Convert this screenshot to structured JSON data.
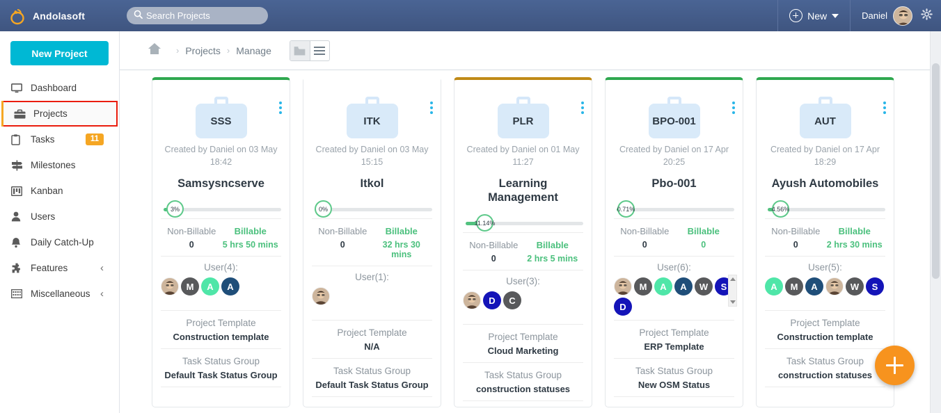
{
  "topbar": {
    "brand": "Andolasoft",
    "logo_icon": "orange-ring-logo-icon",
    "search": {
      "placeholder": "Search Projects",
      "value": "",
      "icon": "search-icon"
    },
    "new_button": {
      "label": "New",
      "icon": "plus-circle-icon",
      "caret": "chevron-down-icon"
    },
    "user_name": "Daniel",
    "avatar_icon": "user-avatar",
    "settings_icon": "gear-icon"
  },
  "sidebar": {
    "new_project_label": "New Project",
    "items": [
      {
        "label": "Dashboard",
        "icon": "monitor-icon",
        "active": false,
        "badge": "",
        "chevron": ""
      },
      {
        "label": "Projects",
        "icon": "briefcase-icon",
        "active": true,
        "badge": "",
        "chevron": ""
      },
      {
        "label": "Tasks",
        "icon": "clipboard-icon",
        "active": false,
        "badge": "11",
        "chevron": ""
      },
      {
        "label": "Milestones",
        "icon": "signpost-icon",
        "active": false,
        "badge": "",
        "chevron": ""
      },
      {
        "label": "Kanban",
        "icon": "kanban-board-icon",
        "active": false,
        "badge": "",
        "chevron": ""
      },
      {
        "label": "Users",
        "icon": "person-icon",
        "active": false,
        "badge": "",
        "chevron": ""
      },
      {
        "label": "Daily Catch-Up",
        "icon": "bell-icon",
        "active": false,
        "badge": "",
        "chevron": ""
      },
      {
        "label": "Features",
        "icon": "puzzle-icon",
        "active": false,
        "badge": "",
        "chevron": "‹"
      },
      {
        "label": "Miscellaneous",
        "icon": "grid-icon",
        "active": false,
        "badge": "",
        "chevron": "‹"
      }
    ]
  },
  "breadcrumb": {
    "home_icon": "home-icon",
    "sep": "›",
    "items": [
      "Projects",
      "Manage"
    ],
    "view_toggle": {
      "grid_label": "grid-view",
      "list_label": "list-view",
      "selected": "grid-view"
    }
  },
  "labels": {
    "non_billable": "Non-Billable",
    "billable": "Billable",
    "project_template": "Project Template",
    "task_status_group": "Task Status Group"
  },
  "fab": {
    "icon": "plus-icon",
    "color": "#f7931e"
  },
  "colors": {
    "accent": "#00b8d4",
    "brand_header": "#4a6494",
    "green": "#4bc07d",
    "orange": "#f7931e",
    "active_outline": "#ea1c0d",
    "card_top_green": "#2fa84f",
    "card_top_gold": "#c08a17"
  },
  "cards": [
    {
      "code": "SSS",
      "top_color": "#2fa84f",
      "created": "Created by Daniel on 03 May 18:42",
      "name": "Samsysncserve",
      "progress_pct": 3,
      "progress_label": "3%",
      "non_billable": "0",
      "billable": "5 hrs 50 mins",
      "users_label": "User(4):",
      "users": [
        {
          "type": "photo",
          "letter": "",
          "color": "#d9c3ae"
        },
        {
          "type": "initial",
          "letter": "M",
          "color": "#58595b"
        },
        {
          "type": "initial",
          "letter": "A",
          "color": "#4fe6a8"
        },
        {
          "type": "initial",
          "letter": "A",
          "color": "#1f4e79"
        }
      ],
      "has_user_scroll": false,
      "template": "Construction template",
      "status_group": "Default Task Status Group"
    },
    {
      "code": "ITK",
      "top_color": "#ffffff",
      "created": "Created by Daniel on 03 May 15:15",
      "name": "Itkol",
      "progress_pct": 0,
      "progress_label": "0%",
      "non_billable": "0",
      "billable": "32 hrs 30 mins",
      "users_label": "User(1):",
      "users": [
        {
          "type": "photo",
          "letter": "",
          "color": "#d9c3ae"
        }
      ],
      "has_user_scroll": false,
      "template": "N/A",
      "status_group": "Default Task Status Group"
    },
    {
      "code": "PLR",
      "top_color": "#c08a17",
      "created": "Created by Daniel on 01 May 11:27",
      "name": "Learning Management",
      "progress_pct": 11.14,
      "progress_label": "11.14%",
      "non_billable": "0",
      "billable": "2 hrs 5 mins",
      "users_label": "User(3):",
      "users": [
        {
          "type": "photo",
          "letter": "",
          "color": "#d9c3ae"
        },
        {
          "type": "initial",
          "letter": "D",
          "color": "#1414b8"
        },
        {
          "type": "initial",
          "letter": "C",
          "color": "#58595b"
        }
      ],
      "has_user_scroll": false,
      "template": "Cloud Marketing",
      "status_group": "construction statuses"
    },
    {
      "code": "BPO-001",
      "top_color": "#2fa84f",
      "created": "Created by Daniel on 17 Apr 20:25",
      "name": "Pbo-001",
      "progress_pct": 0.71,
      "progress_label": "0.71%",
      "non_billable": "0",
      "billable": "0",
      "users_label": "User(6):",
      "users": [
        {
          "type": "photo",
          "letter": "",
          "color": "#d9c3ae"
        },
        {
          "type": "initial",
          "letter": "M",
          "color": "#58595b"
        },
        {
          "type": "initial",
          "letter": "A",
          "color": "#4fe6a8"
        },
        {
          "type": "initial",
          "letter": "A",
          "color": "#1f4e79"
        },
        {
          "type": "initial",
          "letter": "W",
          "color": "#58595b"
        },
        {
          "type": "initial",
          "letter": "S",
          "color": "#1414b8"
        },
        {
          "type": "initial",
          "letter": "D",
          "color": "#1414b8"
        }
      ],
      "has_user_scroll": true,
      "template": "ERP Template",
      "status_group": "New OSM Status"
    },
    {
      "code": "AUT",
      "top_color": "#2fa84f",
      "created": "Created by Daniel on 17 Apr 18:29",
      "name": "Ayush Automobiles",
      "progress_pct": 4.56,
      "progress_label": "4.56%",
      "non_billable": "0",
      "billable": "2 hrs 30 mins",
      "users_label": "User(5):",
      "users": [
        {
          "type": "initial",
          "letter": "A",
          "color": "#4fe6a8"
        },
        {
          "type": "initial",
          "letter": "M",
          "color": "#58595b"
        },
        {
          "type": "initial",
          "letter": "A",
          "color": "#1f4e79"
        },
        {
          "type": "photo",
          "letter": "",
          "color": "#d9c3ae"
        },
        {
          "type": "initial",
          "letter": "W",
          "color": "#58595b"
        },
        {
          "type": "initial",
          "letter": "S",
          "color": "#1414b8"
        }
      ],
      "has_user_scroll": false,
      "template": "Construction template",
      "status_group": "construction statuses"
    }
  ]
}
